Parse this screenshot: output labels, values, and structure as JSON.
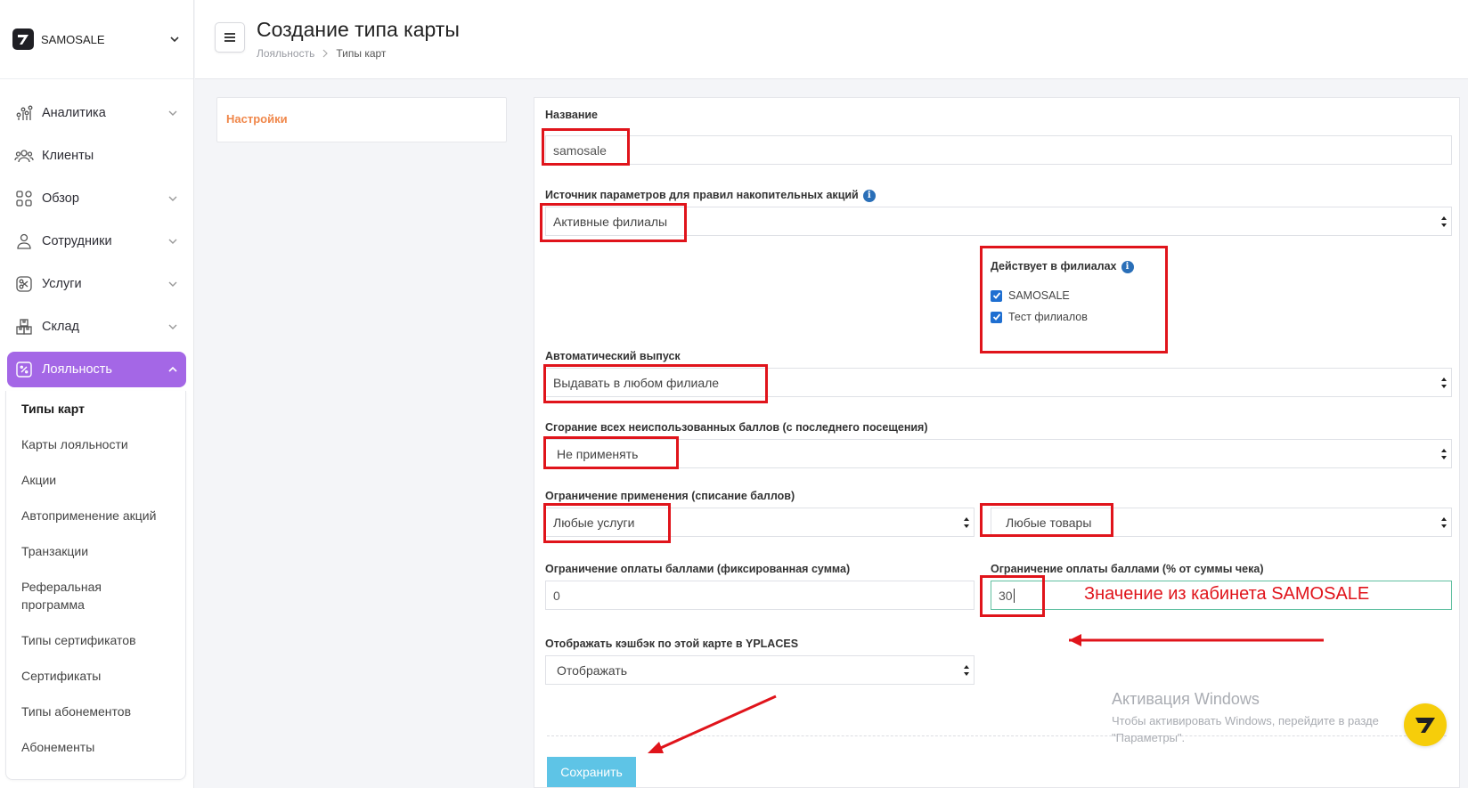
{
  "brand": {
    "name": "SAMOSALE"
  },
  "sidebar": {
    "items": [
      {
        "label": "Аналитика",
        "icon": "analytics-icon",
        "has_chevron": true
      },
      {
        "label": "Клиенты",
        "icon": "clients-icon",
        "has_chevron": false
      },
      {
        "label": "Обзор",
        "icon": "overview-icon",
        "has_chevron": true
      },
      {
        "label": "Сотрудники",
        "icon": "employee-icon",
        "has_chevron": true
      },
      {
        "label": "Услуги",
        "icon": "scissors-icon",
        "has_chevron": true
      },
      {
        "label": "Склад",
        "icon": "warehouse-icon",
        "has_chevron": true
      },
      {
        "label": "Лояльность",
        "icon": "percent-icon",
        "has_chevron": true,
        "active": true
      }
    ],
    "sub_items": [
      "Типы карт",
      "Карты лояльности",
      "Акции",
      "Автоприменение акций",
      "Транзакции",
      "Реферальная программа",
      "Типы сертификатов",
      "Сертификаты",
      "Типы абонементов",
      "Абонементы"
    ]
  },
  "header": {
    "title": "Создание типа карты",
    "breadcrumb": [
      "Лояльность",
      "Типы карт"
    ]
  },
  "tabs": {
    "settings": "Настройки"
  },
  "form": {
    "name_label": "Название",
    "name_value": "samosale",
    "source_label": "Источник параметров для правил накопительных акций",
    "source_value": "Активные филиалы",
    "branches_label": "Действует в филиалах",
    "branches": [
      "SAMOSALE",
      "Тест филиалов"
    ],
    "auto_issue_label": "Автоматический выпуск",
    "auto_issue_value": "Выдавать в любом филиале",
    "expiry_label": "Сгорание всех неиспользованных баллов (с последнего посещения)",
    "expiry_value": "Не применять",
    "restriction_label": "Ограничение применения (списание баллов)",
    "restriction_services": "Любые услуги",
    "restriction_goods": "Любые товары",
    "fixed_limit_label": "Ограничение оплаты баллами (фиксированная сумма)",
    "fixed_limit_value": "0",
    "percent_limit_label": "Ограничение оплаты баллами (% от суммы чека)",
    "percent_limit_value": "30",
    "cashback_label": "Отображать кэшбэк по этой карте в YPLACES",
    "cashback_value": "Отображать",
    "save_label": "Сохранить"
  },
  "annotation": {
    "text": "Значение из кабинета SAMOSALE",
    "color": "#e0141b"
  },
  "windows_activation": {
    "title": "Активация Windows",
    "line1": "Чтобы активировать Windows, перейдите в разде",
    "line2": "\"Параметры\"."
  },
  "colors": {
    "accent_purple": "#a467e6",
    "tab_orange": "#f0874a",
    "save_blue": "#5ec4e6",
    "fab_yellow": "#f6cd0a"
  }
}
